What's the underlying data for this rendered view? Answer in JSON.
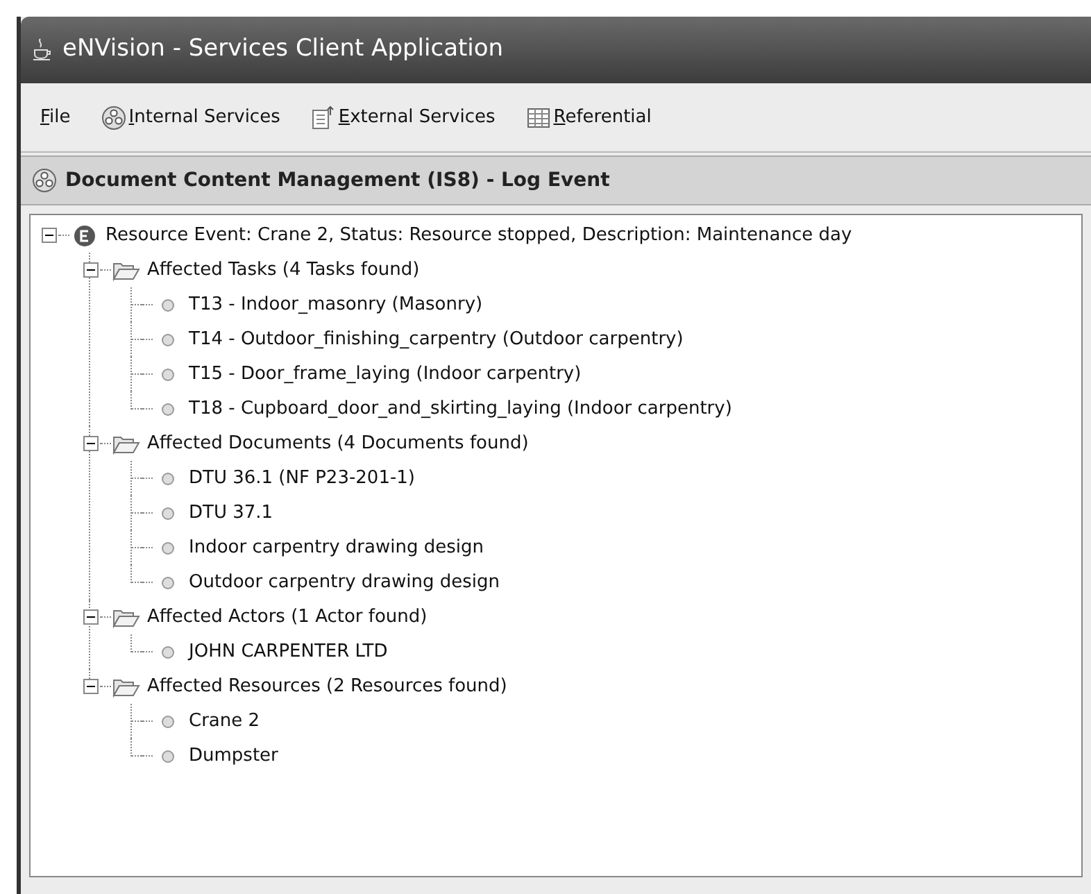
{
  "window": {
    "title": "eNVision - Services Client Application"
  },
  "menu": [
    {
      "label": "File",
      "kind": "plain"
    },
    {
      "label": "Internal Services",
      "kind": "services"
    },
    {
      "label": "External Services",
      "kind": "external"
    },
    {
      "label": "Referential",
      "kind": "table"
    }
  ],
  "panel": {
    "title": "Document Content Management (IS8) - Log Event"
  },
  "tree": [
    {
      "kind": "event",
      "label": "Resource Event: Crane 2, Status: Resource stopped, Description: Maintenance day",
      "expanded": true,
      "children": [
        {
          "kind": "folder",
          "label": "Affected Tasks (4 Tasks found)",
          "expanded": true,
          "children": [
            {
              "kind": "leaf",
              "label": "T13 - Indoor_masonry (Masonry)"
            },
            {
              "kind": "leaf",
              "label": "T14 - Outdoor_finishing_carpentry (Outdoor carpentry)"
            },
            {
              "kind": "leaf",
              "label": "T15 - Door_frame_laying (Indoor carpentry)"
            },
            {
              "kind": "leaf",
              "label": "T18 - Cupboard_door_and_skirting_laying (Indoor carpentry)"
            }
          ]
        },
        {
          "kind": "folder",
          "label": "Affected Documents (4 Documents found)",
          "expanded": true,
          "children": [
            {
              "kind": "leaf",
              "label": "DTU 36.1 (NF P23-201-1)"
            },
            {
              "kind": "leaf",
              "label": "DTU 37.1"
            },
            {
              "kind": "leaf",
              "label": "Indoor carpentry drawing design"
            },
            {
              "kind": "leaf",
              "label": "Outdoor carpentry drawing design"
            }
          ]
        },
        {
          "kind": "folder",
          "label": "Affected Actors (1 Actor found)",
          "expanded": true,
          "children": [
            {
              "kind": "leaf",
              "label": "JOHN CARPENTER LTD"
            }
          ]
        },
        {
          "kind": "folder",
          "label": "Affected Resources (2 Resources found)",
          "expanded": true,
          "children": [
            {
              "kind": "leaf",
              "label": "Crane 2"
            },
            {
              "kind": "leaf",
              "label": "Dumpster"
            }
          ]
        }
      ]
    }
  ]
}
